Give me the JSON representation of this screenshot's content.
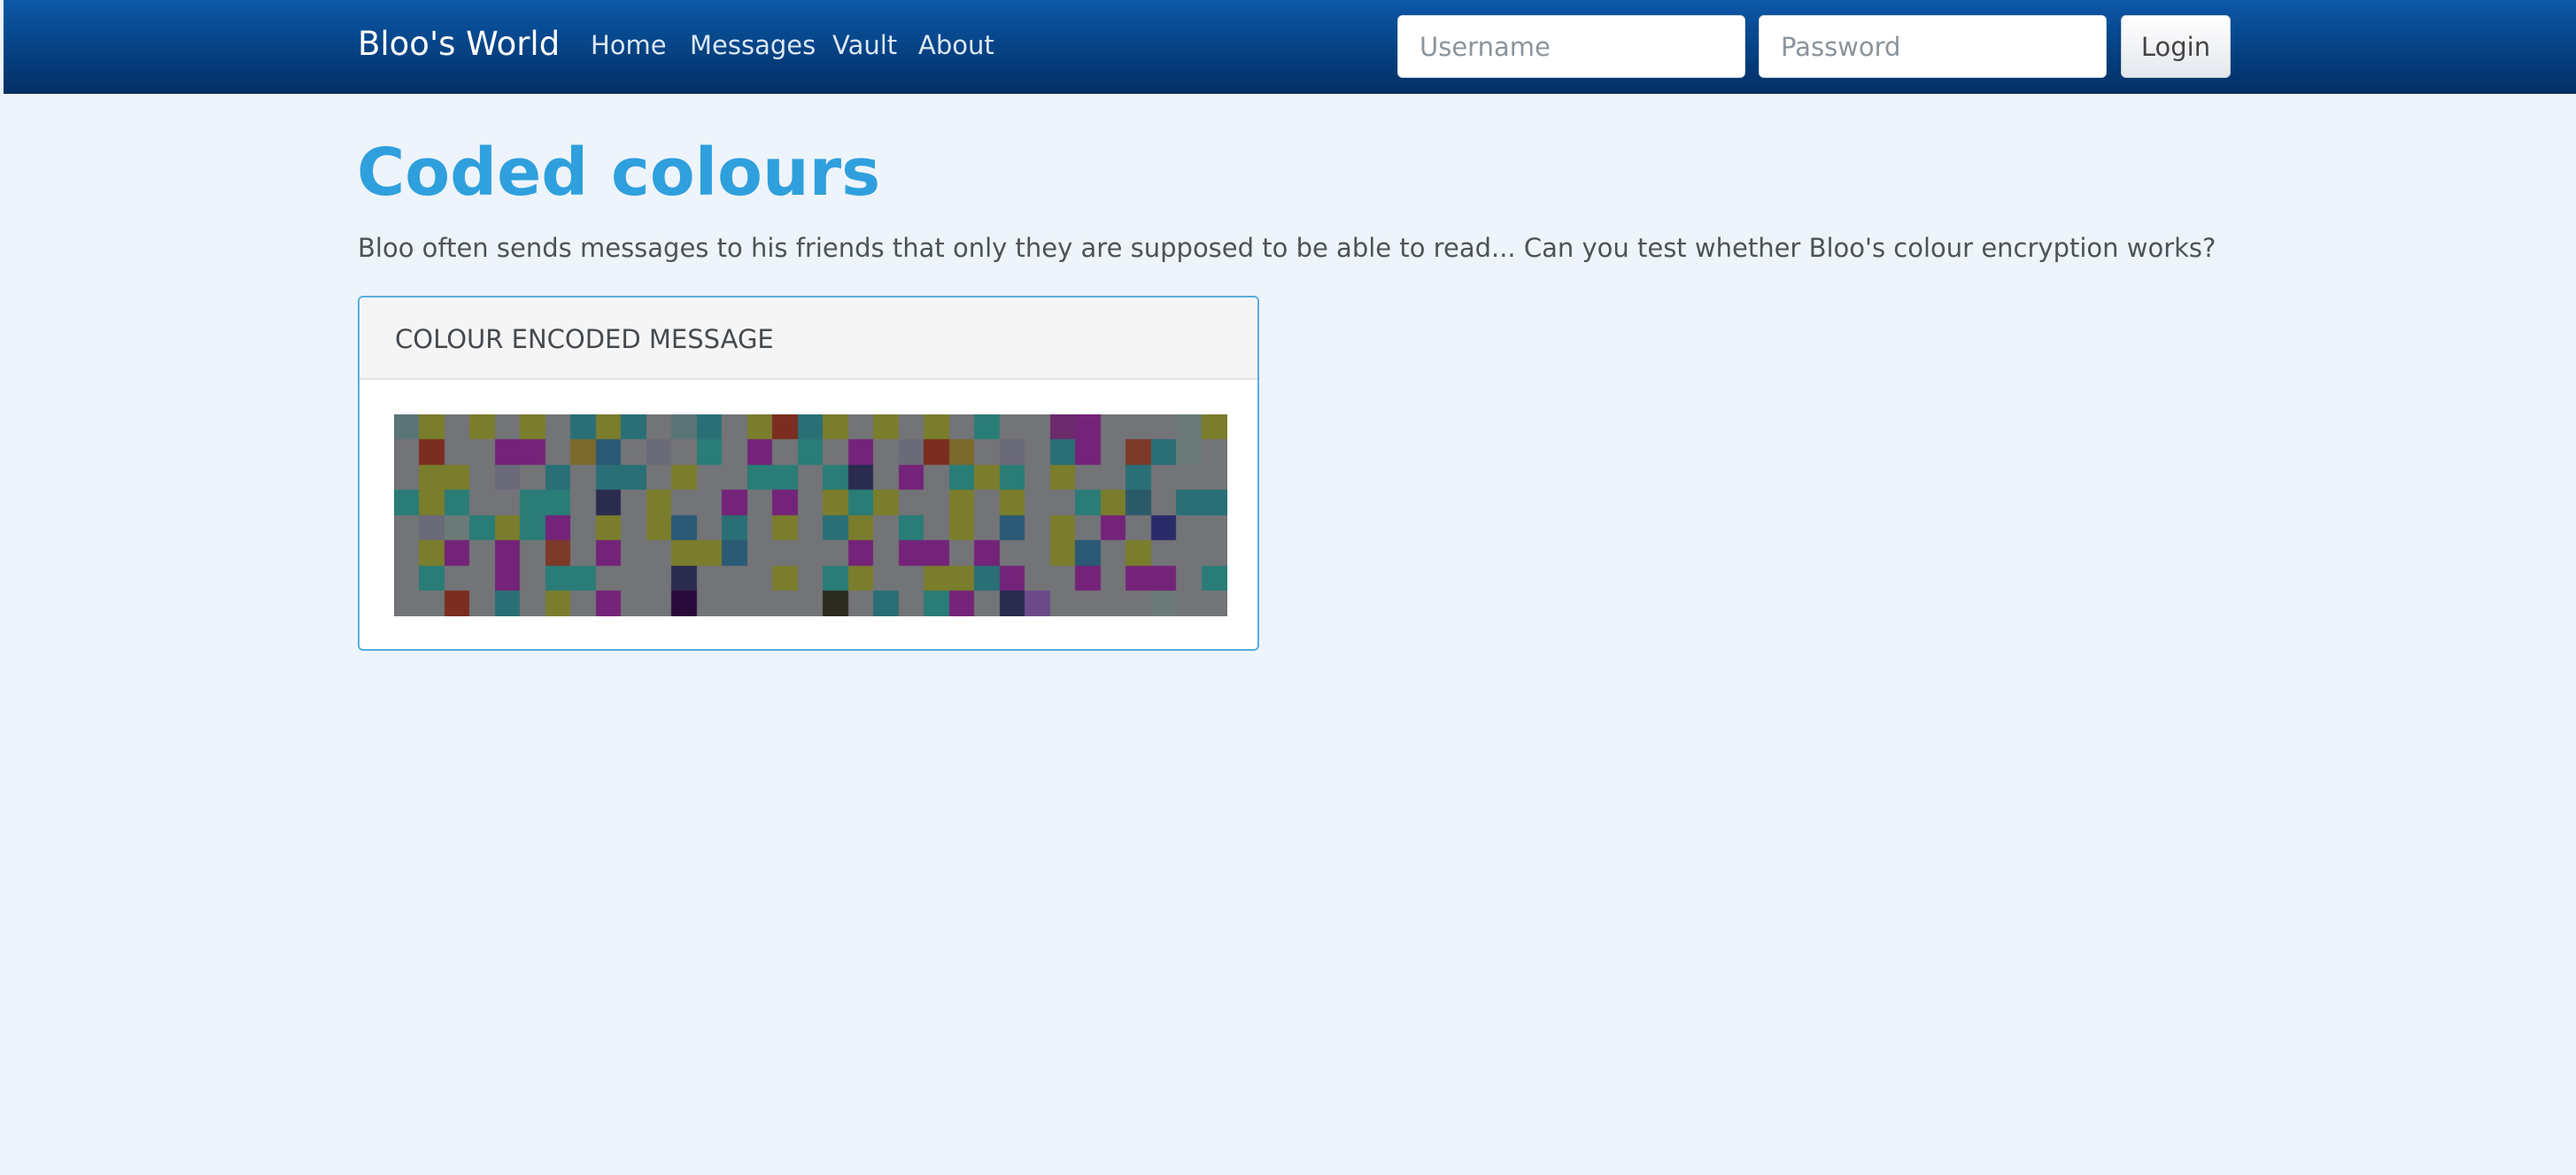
{
  "nav": {
    "brand": "Bloo's World",
    "links": [
      "Home",
      "Messages",
      "Vault",
      "About"
    ],
    "username_placeholder": "Username",
    "password_placeholder": "Password",
    "login_label": "Login"
  },
  "page": {
    "title": "Coded colours",
    "intro": "Bloo often sends messages to his friends that only they are supposed to be able to read... Can you test whether Bloo's colour encryption works?"
  },
  "card": {
    "header": "COLOUR ENCODED MESSAGE",
    "grid_columns": 33,
    "grid_rows": 8,
    "cells": [
      "#5b7476",
      "#7a7d2c",
      "#737478",
      "#7a7d2c",
      "#737478",
      "#7a7d2c",
      "#737478",
      "#2a6f76",
      "#7a7d2c",
      "#2a6f76",
      "#737478",
      "#5b7476",
      "#2a6f76",
      "#737478",
      "#7a7d2c",
      "#7b2d1f",
      "#2a6f76",
      "#7a7d2c",
      "#737478",
      "#7a7d2c",
      "#737478",
      "#7a7d2c",
      "#737478",
      "#2a7c76",
      "#737478",
      "#737478",
      "#6b2a6a",
      "#742478",
      "#737478",
      "#737478",
      "#737478",
      "#6b7a78",
      "#7a7d2c",
      "#737478",
      "#7b2d1f",
      "#737478",
      "#737478",
      "#742478",
      "#742478",
      "#737478",
      "#7a6a2c",
      "#2a5a76",
      "#737478",
      "#6b6a78",
      "#737478",
      "#2a7c76",
      "#737478",
      "#742478",
      "#737478",
      "#2a7c76",
      "#737478",
      "#742478",
      "#737478",
      "#6b6a78",
      "#7b2d1f",
      "#7a6a2c",
      "#737478",
      "#6b6a78",
      "#737478",
      "#2a6f76",
      "#742478",
      "#737478",
      "#7b3a28",
      "#2a6f76",
      "#6b7a78",
      "#737478",
      "#737478",
      "#7a7d2c",
      "#7a7d2c",
      "#737478",
      "#6b6a78",
      "#737478",
      "#2a6f76",
      "#737478",
      "#2a6f76",
      "#2a6f76",
      "#737478",
      "#7a7d2c",
      "#737478",
      "#737478",
      "#2a7c76",
      "#2a7c76",
      "#737478",
      "#2a7c76",
      "#2b2b50",
      "#737478",
      "#742478",
      "#737478",
      "#2a7c76",
      "#7a7d2c",
      "#2a7c76",
      "#737478",
      "#7a7d2c",
      "#737478",
      "#737478",
      "#2a6f76",
      "#737478",
      "#737478",
      "#737478",
      "#2a7c76",
      "#7a7d2c",
      "#2a7c76",
      "#737478",
      "#737478",
      "#2a7c76",
      "#2a7c76",
      "#737478",
      "#2b2b50",
      "#737478",
      "#7a7d2c",
      "#737478",
      "#737478",
      "#742478",
      "#737478",
      "#742478",
      "#737478",
      "#7a7d2c",
      "#2a7c76",
      "#7a7d2c",
      "#737478",
      "#737478",
      "#7a7d2c",
      "#737478",
      "#7a7d2c",
      "#737478",
      "#737478",
      "#2a7c76",
      "#7a7d2c",
      "#2a5a6a",
      "#737478",
      "#2a6f76",
      "#2a6f76",
      "#737478",
      "#6b6a78",
      "#6b7a78",
      "#2a7c76",
      "#7a7d2c",
      "#2a7c76",
      "#742478",
      "#737478",
      "#7a7d2c",
      "#737478",
      "#7a7d2c",
      "#2a5a76",
      "#737478",
      "#2a6f76",
      "#737478",
      "#7a7d2c",
      "#737478",
      "#2a6f76",
      "#7a7d2c",
      "#737478",
      "#2a7c76",
      "#737478",
      "#7a7d2c",
      "#737478",
      "#2a5a76",
      "#737478",
      "#7a7d2c",
      "#737478",
      "#742478",
      "#737478",
      "#2b2b6a",
      "#737478",
      "#737478",
      "#737478",
      "#7a7d2c",
      "#742478",
      "#737478",
      "#742478",
      "#737478",
      "#7b3a28",
      "#737478",
      "#742478",
      "#737478",
      "#737478",
      "#7a7d2c",
      "#7a7d2c",
      "#2a5a76",
      "#737478",
      "#737478",
      "#737478",
      "#737478",
      "#742478",
      "#737478",
      "#742478",
      "#742478",
      "#737478",
      "#742478",
      "#737478",
      "#737478",
      "#7a7d2c",
      "#2a5a76",
      "#737478",
      "#7a7d2c",
      "#737478",
      "#737478",
      "#737478",
      "#737478",
      "#2a7c76",
      "#737478",
      "#737478",
      "#742478",
      "#737478",
      "#2a7c76",
      "#2a7c76",
      "#737478",
      "#737478",
      "#737478",
      "#2b2b50",
      "#737478",
      "#737478",
      "#737478",
      "#7a7d2c",
      "#737478",
      "#2a7c76",
      "#7a7d2c",
      "#737478",
      "#737478",
      "#7a7d2c",
      "#7a7d2c",
      "#2a6f76",
      "#742478",
      "#737478",
      "#737478",
      "#742478",
      "#737478",
      "#742478",
      "#742478",
      "#737478",
      "#2a7c76",
      "#737478",
      "#737478",
      "#7b2d1f",
      "#737478",
      "#2a6f76",
      "#737478",
      "#7a7d2c",
      "#737478",
      "#742478",
      "#737478",
      "#737478",
      "#2a0a3a",
      "#737478",
      "#737478",
      "#737478",
      "#737478",
      "#737478",
      "#2b2b20",
      "#737478",
      "#2a6f76",
      "#737478",
      "#2a7c76",
      "#742478",
      "#737478",
      "#2b2b50",
      "#6b4a8a",
      "#737478",
      "#737478",
      "#737478",
      "#737478",
      "#6b7a78",
      "#737478",
      "#737478"
    ]
  }
}
